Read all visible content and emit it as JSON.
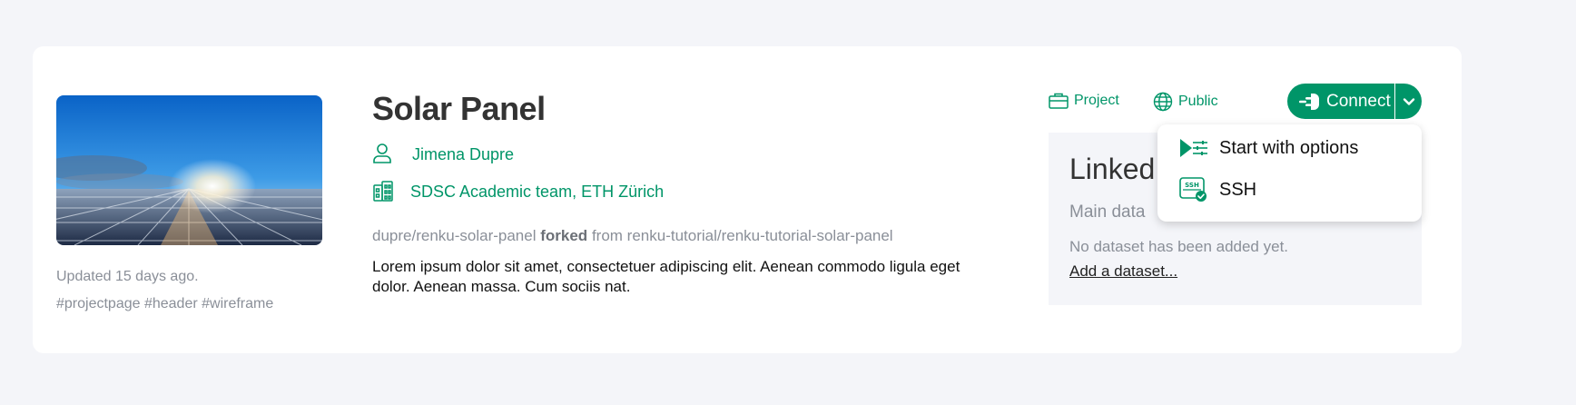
{
  "project": {
    "title": "Solar Panel",
    "author": "Jimena Dupre",
    "organization": "SDSC Academic team, ETH Zürich",
    "fork": {
      "path": "dupre/renku-solar-panel",
      "keyword": "forked",
      "from_label": "from",
      "source": "renku-tutorial/renku-tutorial-solar-panel"
    },
    "description": "Lorem ipsum dolor sit amet, consectetuer adipiscing elit. Aenean commodo ligula eget dolor. Aenean massa. Cum sociis nat.",
    "updated": "Updated 15 days ago.",
    "tags": "#projectpage #header #wireframe"
  },
  "badges": {
    "type_label": "Project",
    "visibility_label": "Public"
  },
  "connect": {
    "label": "Connect",
    "menu": [
      {
        "label": "Start with options",
        "icon": "play-options-icon"
      },
      {
        "label": "SSH",
        "icon": "ssh-icon"
      }
    ]
  },
  "linked": {
    "title": "Linked",
    "subtitle": "Main data",
    "empty_text": "No dataset has been added yet.",
    "add_link": "Add a dataset..."
  },
  "colors": {
    "accent": "#009568",
    "background": "#f4f5f9",
    "card": "#ffffff"
  }
}
